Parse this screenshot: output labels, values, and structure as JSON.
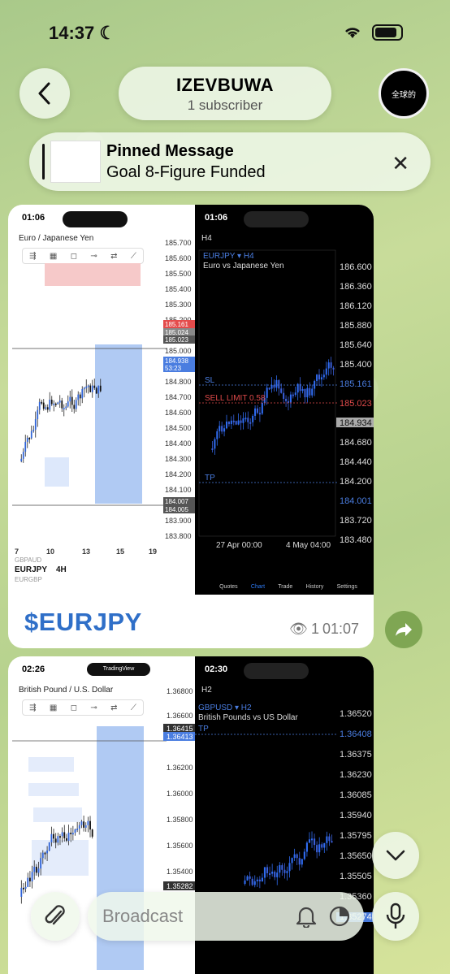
{
  "status": {
    "time": "14:37"
  },
  "header": {
    "channel_name": "IZEVBUWA",
    "subscribers": "1 subscriber",
    "avatar_text": "全球的"
  },
  "pinned": {
    "title": "Pinned Message",
    "text": "Goal 8-Figure Funded"
  },
  "post1": {
    "caption": "$EURJPY",
    "views": "1",
    "time": "01:07",
    "left_shot": {
      "time": "01:06",
      "symbol": "Euro / Japanese Yen",
      "prices": [
        "185.700",
        "185.600",
        "185.500",
        "185.400",
        "185.300",
        "185.200",
        "185.100",
        "185.000",
        "184.900",
        "184.800",
        "184.700",
        "184.600",
        "184.500",
        "184.400",
        "184.300",
        "184.200",
        "184.100",
        "184.000",
        "183.900",
        "183.800"
      ],
      "markers": [
        "185.161",
        "185.024",
        "185.023",
        "184.938",
        "53:23",
        "184.007",
        "184.005"
      ],
      "dates": [
        "7",
        "10",
        "13",
        "15",
        "19"
      ],
      "footer": [
        "GBPAUD",
        "EURJPY",
        "4H",
        "EURGBP"
      ]
    },
    "right_shot": {
      "time": "01:06",
      "timeframe": "H4",
      "symbol_line": "EURJPY ▾ H4",
      "description": "Euro vs Japanese Yen",
      "prices": [
        "186.600",
        "186.360",
        "186.120",
        "185.880",
        "185.640",
        "185.400",
        "185.161",
        "185.023",
        "184.934",
        "184.680",
        "184.440",
        "184.200",
        "184.001",
        "183.720",
        "183.480"
      ],
      "sl": "SL",
      "sell_limit": "SELL LIMIT 0.58",
      "tp": "TP",
      "dates": [
        "27 Apr 00:00",
        "4 May 04:00"
      ],
      "tabs": [
        "Quotes",
        "Chart",
        "Trade",
        "History",
        "Settings"
      ]
    }
  },
  "post2": {
    "left_shot": {
      "time": "02:26",
      "brand": "TradingView",
      "symbol": "British Pound / U.S. Dollar",
      "prices": [
        "1.36800",
        "1.36600",
        "1.36415",
        "1.36413",
        "1.36200",
        "1.36000",
        "1.35800",
        "1.35600",
        "1.35400",
        "1.35282"
      ]
    },
    "right_shot": {
      "time": "02:30",
      "timeframe": "H2",
      "symbol_line": "GBPUSD ▾ H2",
      "description": "British Pounds vs US Dollar",
      "tp": "TP",
      "prices": [
        "1.36520",
        "1.36408",
        "1.36375",
        "1.36230",
        "1.36085",
        "1.35940",
        "1.35795",
        "1.35650",
        "1.35505",
        "1.35360",
        "1.35274"
      ]
    }
  },
  "composer": {
    "placeholder": "Broadcast"
  }
}
